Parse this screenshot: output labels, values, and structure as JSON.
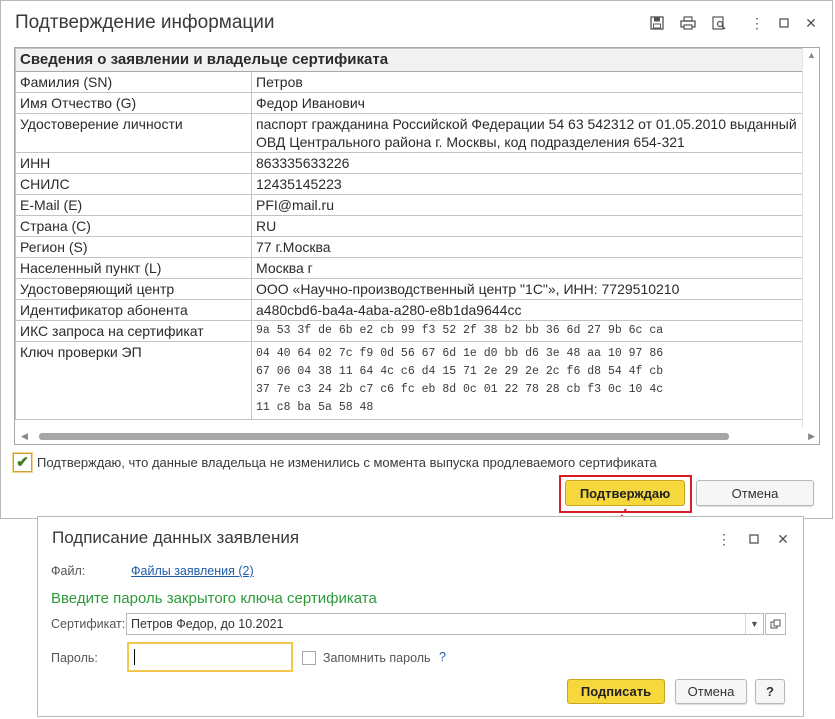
{
  "window1": {
    "title": "Подтверждение информации",
    "table": {
      "header": "Сведения о заявлении и владельце сертификата",
      "rows": [
        {
          "key": "Фамилия (SN)",
          "value": "Петров"
        },
        {
          "key": "Имя Отчество (G)",
          "value": "Федор Иванович"
        },
        {
          "key": "Удостоверение личности",
          "value": "паспорт гражданина Российской Федерации 54 63 542312 от 01.05.2010 выданный ОВД Центрального района г. Москвы, код подразделения 654-321"
        },
        {
          "key": "ИНН",
          "value": "863335633226"
        },
        {
          "key": "СНИЛС",
          "value": "12435145223"
        },
        {
          "key": "E-Mail (E)",
          "value": "PFI@mail.ru"
        },
        {
          "key": "Страна (C)",
          "value": "RU"
        },
        {
          "key": "Регион (S)",
          "value": "77 г.Москва"
        },
        {
          "key": "Населенный пункт (L)",
          "value": "Москва г"
        },
        {
          "key": "Удостоверяющий центр",
          "value": "ООО «Научно-производственный центр \"1С\"», ИНН: 7729510210"
        },
        {
          "key": "Идентификатор абонента",
          "value": "a480cbd6-ba4a-4aba-a280-e8b1da9644cc"
        }
      ],
      "iks_key": "ИКС запроса на сертификат",
      "iks_value": "9a 53 3f de 6b e2 cb 99 f3 52 2f 38 b2 bb 36 6d 27 9b 6c ca",
      "pubkey_key": "Ключ проверки ЭП",
      "pubkey_lines": [
        "04 40 64 02 7c f9 0d 56 67 6d 1e d0 bb d6 3e 48 aa 10 97 86",
        "67 06 04 38 11 64 4c c6 d4 15 71 2e 29 2e 2c f6 d8 54 4f cb",
        "37 7e c3 24 2b c7 c6 fc eb 8d 0c 01 22 78 28 cb f3 0c 10 4c",
        "11 c8 ba 5a 58 48"
      ]
    },
    "confirm_text": "Подтверждаю, что данные владельца не изменились с момента выпуска продлеваемого сертификата",
    "confirm_checked": true,
    "btn_confirm": "Подтверждаю",
    "btn_cancel": "Отмена",
    "highlight_color": "#d81d27"
  },
  "window2": {
    "title": "Подписание данных заявления",
    "file_label": "Файл:",
    "file_link": "Файлы заявления (2)",
    "heading": "Введите пароль закрытого ключа сертификата",
    "cert_label": "Сертификат:",
    "cert_value": "Петров Федор, до 10.2021",
    "password_label": "Пароль:",
    "password_value": "",
    "remember_label": "Запомнить пароль",
    "help": "?",
    "btn_sign": "Подписать",
    "btn_cancel": "Отмена",
    "btn_help": "?"
  },
  "colors": {
    "accent_yellow": "#f7d83c",
    "link_blue": "#1f5ea8",
    "heading_green": "#2e9a3a"
  }
}
